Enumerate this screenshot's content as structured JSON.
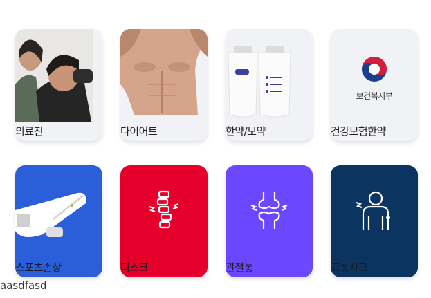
{
  "categories": [
    {
      "label": "의료진",
      "icon": "medical-staff-photo",
      "bg": "#f1f2f6"
    },
    {
      "label": "다이어트",
      "icon": "diet-body-photo",
      "bg": "#f1f2f6"
    },
    {
      "label": "한약/보약",
      "icon": "herbal-pouch-photo",
      "bg": "#f1f2f6"
    },
    {
      "label": "건강보험한약",
      "icon": "mohw-logo",
      "bg": "#f1f2f6",
      "logo_text": "보건복지부"
    },
    {
      "label": "스포츠손상",
      "icon": "sports-injury-device",
      "bg": "#2a5fd9"
    },
    {
      "label": "디스크",
      "icon": "spine-icon",
      "bg": "#e4002b"
    },
    {
      "label": "관절통",
      "icon": "joint-pain-icon",
      "bg": "#6b47ff"
    },
    {
      "label": "교통사고",
      "icon": "accident-body-icon",
      "bg": "#0b3461"
    }
  ],
  "footer": {
    "text": "aasdfasd"
  }
}
